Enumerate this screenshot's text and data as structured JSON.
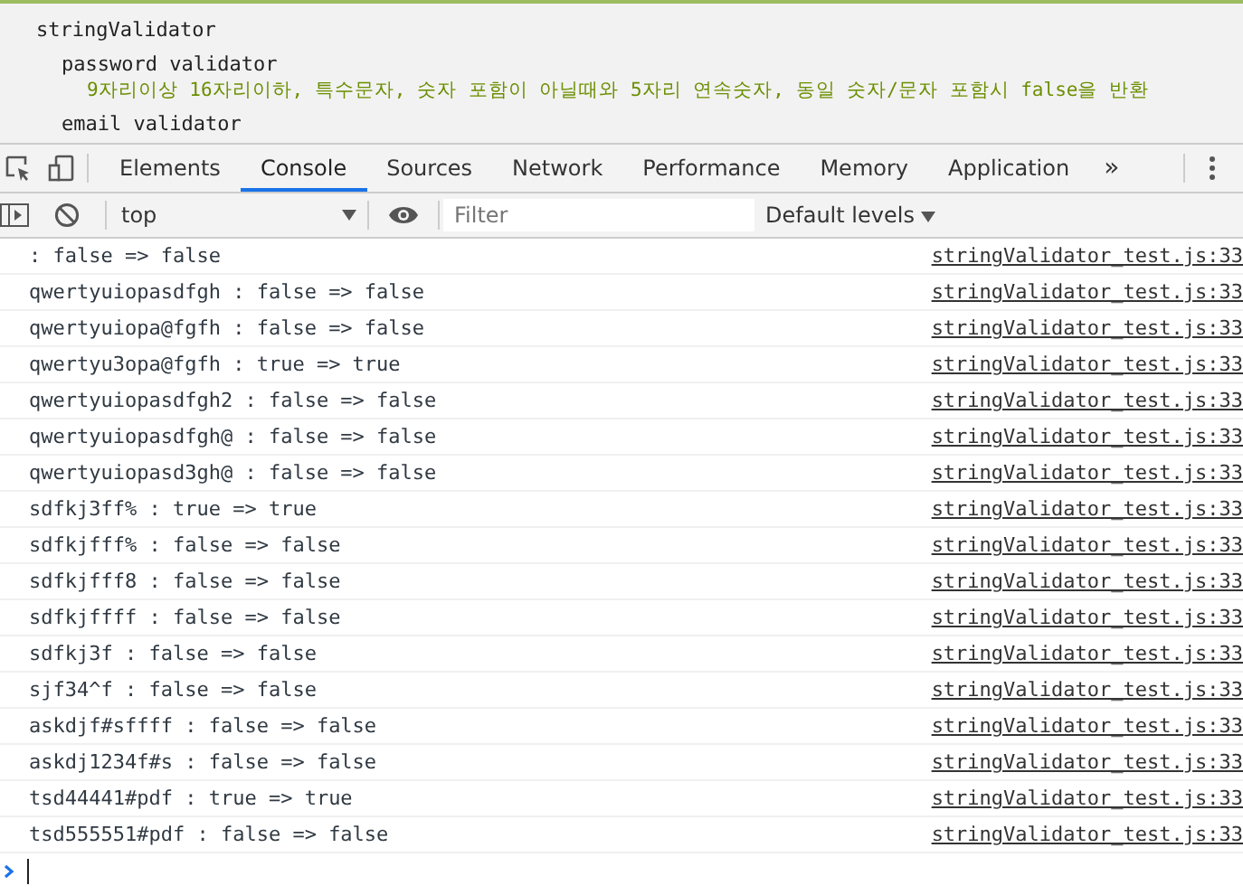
{
  "page": {
    "lines": [
      {
        "kind": "title",
        "text": "stringValidator"
      },
      {
        "kind": "heading",
        "text": "password validator"
      },
      {
        "kind": "note",
        "text": "9자리이상 16자리이하, 특수문자, 숫자 포함이 아닐때와 5자리 연속숫자, 동일 숫자/문자 포함시 false을 반환"
      },
      {
        "kind": "heading",
        "text": "email validator"
      }
    ]
  },
  "devtools": {
    "tabs": [
      {
        "label": "Elements",
        "selected": false
      },
      {
        "label": "Console",
        "selected": true
      },
      {
        "label": "Sources",
        "selected": false
      },
      {
        "label": "Network",
        "selected": false
      },
      {
        "label": "Performance",
        "selected": false
      },
      {
        "label": "Memory",
        "selected": false
      },
      {
        "label": "Application",
        "selected": false
      }
    ],
    "more_tabs": "»",
    "context": "top",
    "filter": {
      "placeholder": "Filter"
    },
    "levels": "Default levels",
    "messages": [
      {
        "text": " : false => false",
        "source": "stringValidator_test.js:33"
      },
      {
        "text": "qwertyuiopasdfgh : false => false",
        "source": "stringValidator_test.js:33"
      },
      {
        "text": "qwertyuiopa@fgfh : false => false",
        "source": "stringValidator_test.js:33"
      },
      {
        "text": "qwertyu3opa@fgfh : true => true",
        "source": "stringValidator_test.js:33"
      },
      {
        "text": "qwertyuiopasdfgh2 : false => false",
        "source": "stringValidator_test.js:33"
      },
      {
        "text": "qwertyuiopasdfgh@ : false => false",
        "source": "stringValidator_test.js:33"
      },
      {
        "text": "qwertyuiopasd3gh@ : false => false",
        "source": "stringValidator_test.js:33"
      },
      {
        "text": "sdfkj3ff% : true => true",
        "source": "stringValidator_test.js:33"
      },
      {
        "text": "sdfkjfff% : false => false",
        "source": "stringValidator_test.js:33"
      },
      {
        "text": "sdfkjfff8 : false => false",
        "source": "stringValidator_test.js:33"
      },
      {
        "text": "sdfkjffff : false => false",
        "source": "stringValidator_test.js:33"
      },
      {
        "text": "sdfkj3f : false => false",
        "source": "stringValidator_test.js:33"
      },
      {
        "text": "sjf34^f : false => false",
        "source": "stringValidator_test.js:33"
      },
      {
        "text": "askdjf#sffff : false => false",
        "source": "stringValidator_test.js:33"
      },
      {
        "text": "askdj1234f#s : false => false",
        "source": "stringValidator_test.js:33"
      },
      {
        "text": "tsd44441#pdf : true => true",
        "source": "stringValidator_test.js:33"
      },
      {
        "text": "tsd555551#pdf : false => false",
        "source": "stringValidator_test.js:33"
      }
    ]
  }
}
